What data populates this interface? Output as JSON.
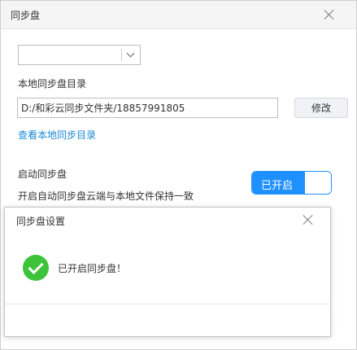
{
  "window": {
    "title": "同步盘",
    "close_icon": "close-icon"
  },
  "sync": {
    "account_select": {
      "value": "",
      "icon": "chevron-down-icon"
    },
    "local_dir_label": "本地同步盘目录",
    "local_dir_path": "D:/和彩云同步文件夹/18857991805",
    "modify_button": "修改",
    "view_local_link": "查看本地同步目录",
    "enable_label": "启动同步盘",
    "enable_desc": "开启自动同步盘云端与本地文件保持一致",
    "toggle_text": "已开启",
    "toggle_on": true
  },
  "dialog": {
    "title": "同步盘设置",
    "message": "已开启同步盘！",
    "success_icon": "check-circle-icon",
    "close_icon": "close-icon"
  },
  "colors": {
    "accent": "#1e90ff",
    "link": "#1a8bd6",
    "success": "#3cc33a"
  }
}
